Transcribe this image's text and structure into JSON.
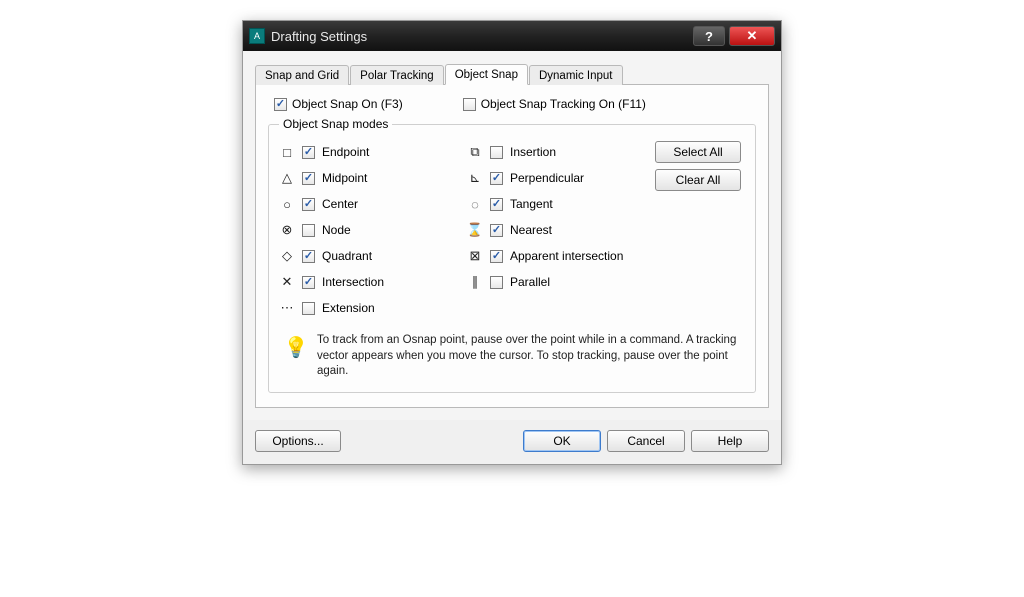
{
  "window": {
    "title": "Drafting Settings"
  },
  "tabs": [
    "Snap and Grid",
    "Polar Tracking",
    "Object Snap",
    "Dynamic Input"
  ],
  "activeTab": 2,
  "objectSnapOn": {
    "label": "Object Snap On (F3)",
    "checked": true
  },
  "objectSnapTracking": {
    "label": "Object Snap Tracking On (F11)",
    "checked": false
  },
  "modesGroup": "Object Snap modes",
  "leftModes": [
    {
      "icon": "□",
      "name": "endpoint-icon",
      "label": "Endpoint",
      "checked": true
    },
    {
      "icon": "△",
      "name": "midpoint-icon",
      "label": "Midpoint",
      "checked": true
    },
    {
      "icon": "○",
      "name": "center-icon",
      "label": "Center",
      "checked": true
    },
    {
      "icon": "⊗",
      "name": "node-icon",
      "label": "Node",
      "checked": false
    },
    {
      "icon": "◇",
      "name": "quadrant-icon",
      "label": "Quadrant",
      "checked": true
    },
    {
      "icon": "✕",
      "name": "intersection-icon",
      "label": "Intersection",
      "checked": true
    },
    {
      "icon": "⋯",
      "name": "extension-icon",
      "label": "Extension",
      "checked": false
    }
  ],
  "rightModes": [
    {
      "icon": "⧉",
      "name": "insertion-icon",
      "label": "Insertion",
      "checked": false
    },
    {
      "icon": "⊾",
      "name": "perpendicular-icon",
      "label": "Perpendicular",
      "checked": true
    },
    {
      "icon": "◌",
      "name": "tangent-icon",
      "label": "Tangent",
      "checked": true
    },
    {
      "icon": "⌛",
      "name": "nearest-icon",
      "label": "Nearest",
      "checked": true
    },
    {
      "icon": "⊠",
      "name": "apparent-intersection-icon",
      "label": "Apparent intersection",
      "checked": true
    },
    {
      "icon": "∥",
      "name": "parallel-icon",
      "label": "Parallel",
      "checked": false
    }
  ],
  "buttons": {
    "selectAll": "Select All",
    "clearAll": "Clear All",
    "options": "Options...",
    "ok": "OK",
    "cancel": "Cancel",
    "help": "Help"
  },
  "hint": "To track from an Osnap point, pause over the point while in a command.  A tracking vector appears when you move the cursor.  To stop tracking, pause over the point again."
}
